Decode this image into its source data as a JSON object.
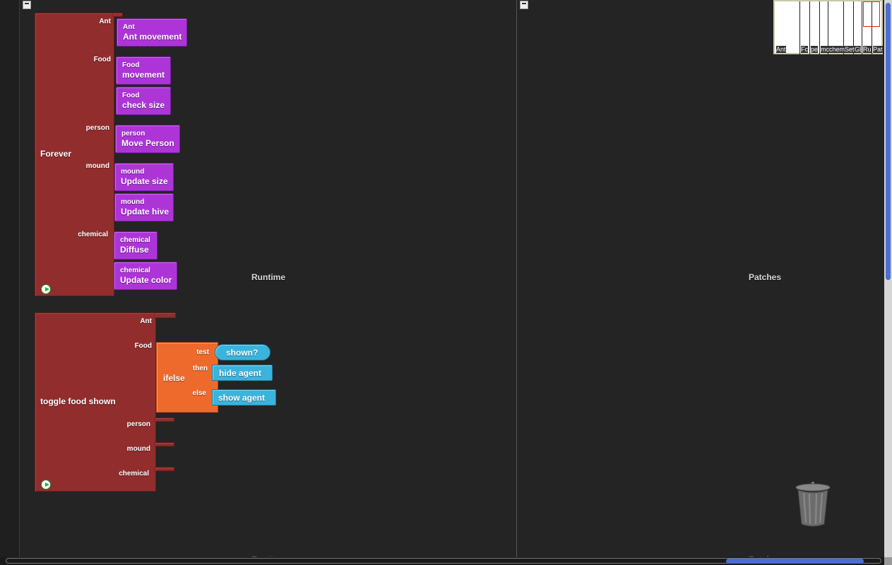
{
  "pages": {
    "runtime": {
      "label": "Runtime"
    },
    "patches": {
      "label": "Patches"
    }
  },
  "forever_block": {
    "label": "Forever",
    "sections": [
      {
        "name": "Ant",
        "blocks": [
          {
            "breed": "Ant",
            "name": "Ant movement"
          }
        ]
      },
      {
        "name": "Food",
        "blocks": [
          {
            "breed": "Food",
            "name": "movement"
          },
          {
            "breed": "Food",
            "name": "check size"
          }
        ]
      },
      {
        "name": "person",
        "blocks": [
          {
            "breed": "person",
            "name": "Move Person"
          }
        ]
      },
      {
        "name": "mound",
        "blocks": [
          {
            "breed": "mound",
            "name": "Update size"
          },
          {
            "breed": "mound",
            "name": "Update hive"
          }
        ]
      },
      {
        "name": "chemical",
        "blocks": [
          {
            "breed": "chemical",
            "name": "Diffuse"
          },
          {
            "breed": "chemical",
            "name": "Update color"
          }
        ]
      }
    ]
  },
  "toggle_block": {
    "label": "toggle food shown",
    "sections": [
      "Ant",
      "Food",
      "person",
      "mound",
      "chemical"
    ],
    "ifelse": {
      "label": "ifelse",
      "test_label": "test",
      "then_label": "then",
      "else_label": "else",
      "test": "shown?",
      "then": "hide agent",
      "else": "show agent"
    }
  },
  "minimap": {
    "labels": [
      "Ant",
      "Food",
      "person",
      "mound",
      "chemical",
      "Setup",
      "Global",
      "Runtime",
      "Patches"
    ],
    "visible_labels": [
      "Ant",
      "Fc",
      "pe",
      "mc",
      "chem",
      "Set",
      "Gl",
      "Ru",
      "Pat"
    ]
  },
  "colors": {
    "agent_block": "#912d2d",
    "procedure_block": "#ad35d8",
    "control_block": "#ee6a2c",
    "command_block": "#3ab4dd",
    "scroll_thumb": "#4a6ed6"
  },
  "icons": [
    "collapse-icon",
    "run-icon",
    "trash-icon"
  ]
}
